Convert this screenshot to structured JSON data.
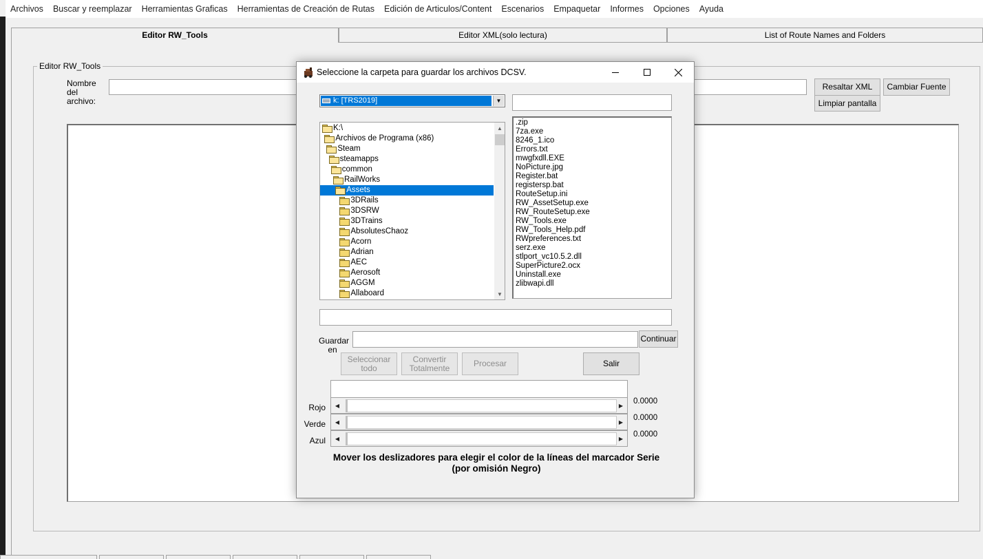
{
  "menubar": {
    "items": [
      "Archivos",
      "Buscar y reemplazar",
      "Herramientas Graficas",
      "Herramientas de Creación de Rutas",
      "Edición de Articulos/Content",
      "Escenarios",
      "Empaquetar",
      "Informes",
      "Opciones",
      "Ayuda"
    ]
  },
  "tabs": [
    {
      "label": "Editor RW_Tools",
      "active": true
    },
    {
      "label": "Editor XML(solo lectura)",
      "active": false
    },
    {
      "label": "List of Route Names and Folders",
      "active": false
    }
  ],
  "editor": {
    "group_title": "Editor RW_Tools",
    "filename_label": "Nombre del archivo:",
    "filename_value": "",
    "highlight_button": "Resaltar XML",
    "change_font_button": "Cambiar Fuente",
    "clear_button": "Limpiar pantalla"
  },
  "dialog": {
    "title": "Seleccione la carpeta para guardar los archivos DCSV.",
    "drive": "k: [TRS2019]",
    "filter_value": "",
    "folders": [
      {
        "name": "K:\\",
        "level": 0,
        "open": true,
        "selected": false
      },
      {
        "name": "Archivos de Programa (x86)",
        "level": 1,
        "open": true,
        "selected": false
      },
      {
        "name": "Steam",
        "level": 2,
        "open": true,
        "selected": false
      },
      {
        "name": "steamapps",
        "level": 3,
        "open": true,
        "selected": false
      },
      {
        "name": "common",
        "level": 4,
        "open": true,
        "selected": false
      },
      {
        "name": "RailWorks",
        "level": 5,
        "open": true,
        "selected": false
      },
      {
        "name": "Assets",
        "level": 6,
        "open": true,
        "selected": true
      },
      {
        "name": "3DRails",
        "level": 7,
        "open": false,
        "selected": false
      },
      {
        "name": "3DSRW",
        "level": 7,
        "open": false,
        "selected": false
      },
      {
        "name": "3DTrains",
        "level": 7,
        "open": false,
        "selected": false
      },
      {
        "name": "AbsolutesChaoz",
        "level": 7,
        "open": false,
        "selected": false
      },
      {
        "name": "Acorn",
        "level": 7,
        "open": false,
        "selected": false
      },
      {
        "name": "Adrian",
        "level": 7,
        "open": false,
        "selected": false
      },
      {
        "name": "AEC",
        "level": 7,
        "open": false,
        "selected": false
      },
      {
        "name": "Aerosoft",
        "level": 7,
        "open": false,
        "selected": false
      },
      {
        "name": "AGGM",
        "level": 7,
        "open": false,
        "selected": false
      },
      {
        "name": "Allaboard",
        "level": 7,
        "open": false,
        "selected": false
      }
    ],
    "files": [
      ".zip",
      "7za.exe",
      "8246_1.ico",
      "Errors.txt",
      "mwgfxdll.EXE",
      "NoPicture.jpg",
      "Register.bat",
      "registersp.bat",
      "RouteSetup.ini",
      "RW_AssetSetup.exe",
      "RW_RouteSetup.exe",
      "RW_Tools.exe",
      "RW_Tools_Help.pdf",
      "RWpreferences.txt",
      "serz.exe",
      "stlport_vc10.5.2.dll",
      "SuperPicture2.ocx",
      "Uninstall.exe",
      "zlibwapi.dll"
    ],
    "path_value": "",
    "save_label": "Guardar en",
    "save_value": "",
    "continue_button": "Continuar",
    "select_all_button": "Seleccionar todo",
    "convert_button": "Convertir Totalmente",
    "process_button": "Procesar",
    "exit_button": "Salir",
    "sliders": [
      {
        "label": "Rojo",
        "value": "0.0000"
      },
      {
        "label": "Verde",
        "value": "0.0000"
      },
      {
        "label": "Azul",
        "value": "0.0000"
      }
    ],
    "instruction": "Mover los deslizadores para elegir el color de la líneas del marcador Serie (por omisión Negro)"
  }
}
